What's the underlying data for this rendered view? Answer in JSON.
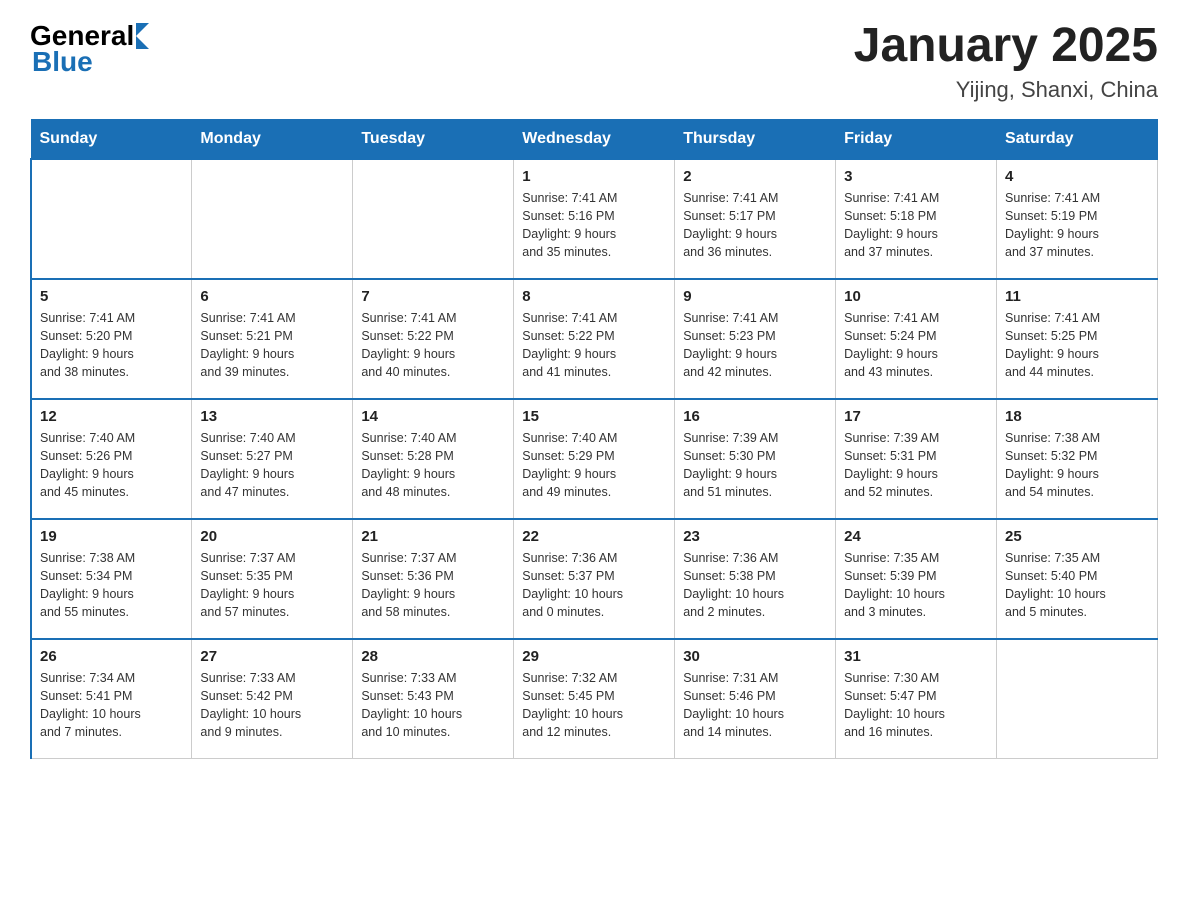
{
  "header": {
    "logo_general": "General",
    "logo_blue": "Blue",
    "title": "January 2025",
    "subtitle": "Yijing, Shanxi, China"
  },
  "days_of_week": [
    "Sunday",
    "Monday",
    "Tuesday",
    "Wednesday",
    "Thursday",
    "Friday",
    "Saturday"
  ],
  "weeks": [
    [
      {
        "day": "",
        "info": ""
      },
      {
        "day": "",
        "info": ""
      },
      {
        "day": "",
        "info": ""
      },
      {
        "day": "1",
        "info": "Sunrise: 7:41 AM\nSunset: 5:16 PM\nDaylight: 9 hours\nand 35 minutes."
      },
      {
        "day": "2",
        "info": "Sunrise: 7:41 AM\nSunset: 5:17 PM\nDaylight: 9 hours\nand 36 minutes."
      },
      {
        "day": "3",
        "info": "Sunrise: 7:41 AM\nSunset: 5:18 PM\nDaylight: 9 hours\nand 37 minutes."
      },
      {
        "day": "4",
        "info": "Sunrise: 7:41 AM\nSunset: 5:19 PM\nDaylight: 9 hours\nand 37 minutes."
      }
    ],
    [
      {
        "day": "5",
        "info": "Sunrise: 7:41 AM\nSunset: 5:20 PM\nDaylight: 9 hours\nand 38 minutes."
      },
      {
        "day": "6",
        "info": "Sunrise: 7:41 AM\nSunset: 5:21 PM\nDaylight: 9 hours\nand 39 minutes."
      },
      {
        "day": "7",
        "info": "Sunrise: 7:41 AM\nSunset: 5:22 PM\nDaylight: 9 hours\nand 40 minutes."
      },
      {
        "day": "8",
        "info": "Sunrise: 7:41 AM\nSunset: 5:22 PM\nDaylight: 9 hours\nand 41 minutes."
      },
      {
        "day": "9",
        "info": "Sunrise: 7:41 AM\nSunset: 5:23 PM\nDaylight: 9 hours\nand 42 minutes."
      },
      {
        "day": "10",
        "info": "Sunrise: 7:41 AM\nSunset: 5:24 PM\nDaylight: 9 hours\nand 43 minutes."
      },
      {
        "day": "11",
        "info": "Sunrise: 7:41 AM\nSunset: 5:25 PM\nDaylight: 9 hours\nand 44 minutes."
      }
    ],
    [
      {
        "day": "12",
        "info": "Sunrise: 7:40 AM\nSunset: 5:26 PM\nDaylight: 9 hours\nand 45 minutes."
      },
      {
        "day": "13",
        "info": "Sunrise: 7:40 AM\nSunset: 5:27 PM\nDaylight: 9 hours\nand 47 minutes."
      },
      {
        "day": "14",
        "info": "Sunrise: 7:40 AM\nSunset: 5:28 PM\nDaylight: 9 hours\nand 48 minutes."
      },
      {
        "day": "15",
        "info": "Sunrise: 7:40 AM\nSunset: 5:29 PM\nDaylight: 9 hours\nand 49 minutes."
      },
      {
        "day": "16",
        "info": "Sunrise: 7:39 AM\nSunset: 5:30 PM\nDaylight: 9 hours\nand 51 minutes."
      },
      {
        "day": "17",
        "info": "Sunrise: 7:39 AM\nSunset: 5:31 PM\nDaylight: 9 hours\nand 52 minutes."
      },
      {
        "day": "18",
        "info": "Sunrise: 7:38 AM\nSunset: 5:32 PM\nDaylight: 9 hours\nand 54 minutes."
      }
    ],
    [
      {
        "day": "19",
        "info": "Sunrise: 7:38 AM\nSunset: 5:34 PM\nDaylight: 9 hours\nand 55 minutes."
      },
      {
        "day": "20",
        "info": "Sunrise: 7:37 AM\nSunset: 5:35 PM\nDaylight: 9 hours\nand 57 minutes."
      },
      {
        "day": "21",
        "info": "Sunrise: 7:37 AM\nSunset: 5:36 PM\nDaylight: 9 hours\nand 58 minutes."
      },
      {
        "day": "22",
        "info": "Sunrise: 7:36 AM\nSunset: 5:37 PM\nDaylight: 10 hours\nand 0 minutes."
      },
      {
        "day": "23",
        "info": "Sunrise: 7:36 AM\nSunset: 5:38 PM\nDaylight: 10 hours\nand 2 minutes."
      },
      {
        "day": "24",
        "info": "Sunrise: 7:35 AM\nSunset: 5:39 PM\nDaylight: 10 hours\nand 3 minutes."
      },
      {
        "day": "25",
        "info": "Sunrise: 7:35 AM\nSunset: 5:40 PM\nDaylight: 10 hours\nand 5 minutes."
      }
    ],
    [
      {
        "day": "26",
        "info": "Sunrise: 7:34 AM\nSunset: 5:41 PM\nDaylight: 10 hours\nand 7 minutes."
      },
      {
        "day": "27",
        "info": "Sunrise: 7:33 AM\nSunset: 5:42 PM\nDaylight: 10 hours\nand 9 minutes."
      },
      {
        "day": "28",
        "info": "Sunrise: 7:33 AM\nSunset: 5:43 PM\nDaylight: 10 hours\nand 10 minutes."
      },
      {
        "day": "29",
        "info": "Sunrise: 7:32 AM\nSunset: 5:45 PM\nDaylight: 10 hours\nand 12 minutes."
      },
      {
        "day": "30",
        "info": "Sunrise: 7:31 AM\nSunset: 5:46 PM\nDaylight: 10 hours\nand 14 minutes."
      },
      {
        "day": "31",
        "info": "Sunrise: 7:30 AM\nSunset: 5:47 PM\nDaylight: 10 hours\nand 16 minutes."
      },
      {
        "day": "",
        "info": ""
      }
    ]
  ]
}
